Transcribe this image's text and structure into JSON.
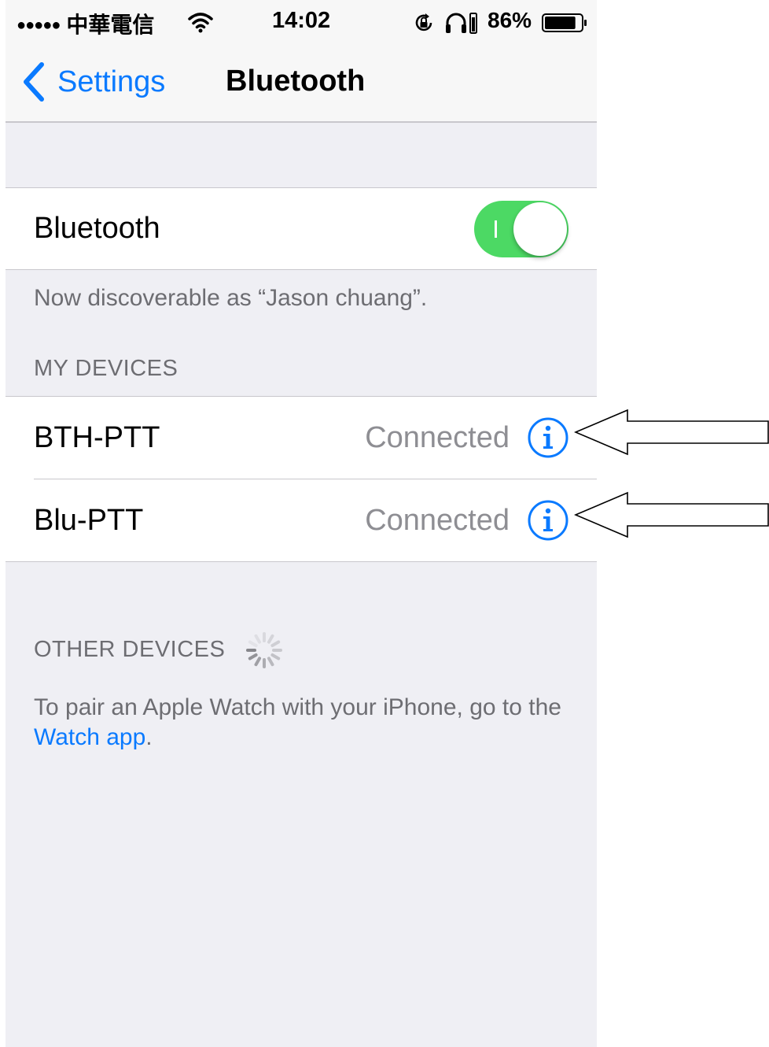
{
  "colors": {
    "accent": "#0a7aff",
    "toggle_on": "#4cd964",
    "background": "#efeff4",
    "secondary_text": "#6d6d72",
    "status_text": "#8e8e93"
  },
  "status_bar": {
    "signal_dots": "●●●●●",
    "carrier": "中華電信",
    "wifi_icon": "wifi-icon",
    "time": "14:02",
    "rotation_lock_icon": "rotation-lock-icon",
    "headphones_icon": "headphones-icon",
    "battery_percent": "86%",
    "battery_level": 0.86
  },
  "nav": {
    "back_label": "Settings",
    "title": "Bluetooth"
  },
  "bluetooth": {
    "label": "Bluetooth",
    "enabled": true,
    "discoverable_text": "Now discoverable as “Jason chuang”."
  },
  "my_devices": {
    "header": "MY DEVICES",
    "items": [
      {
        "name": "BTH-PTT",
        "status": "Connected"
      },
      {
        "name": "Blu-PTT",
        "status": "Connected"
      }
    ]
  },
  "other_devices": {
    "header": "OTHER DEVICES",
    "watch_text_prefix": "To pair an Apple Watch with your iPhone, go to the ",
    "watch_link": "Watch app",
    "watch_text_suffix": "."
  }
}
